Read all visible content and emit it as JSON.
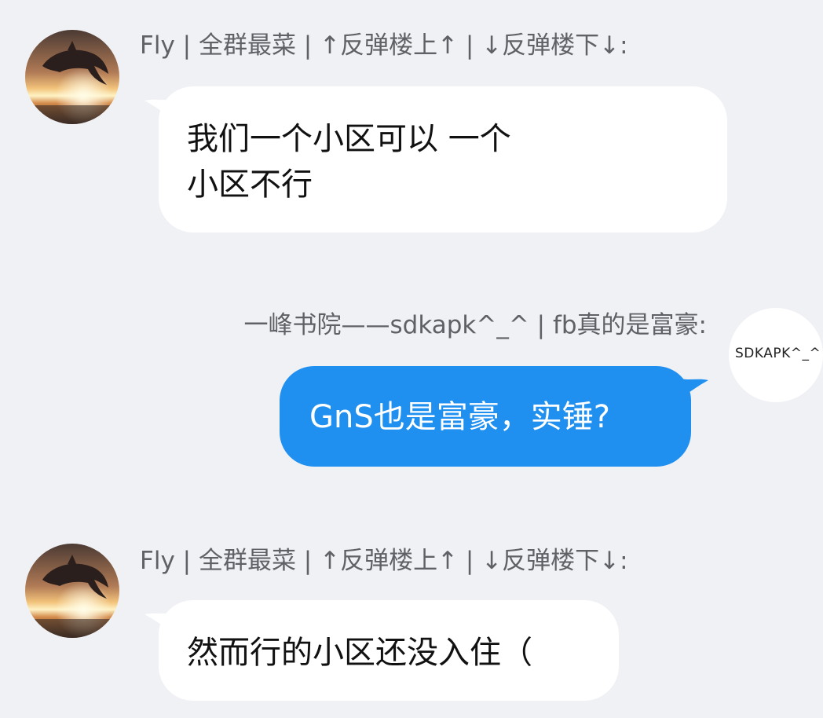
{
  "messages": [
    {
      "direction": "incoming",
      "sender": "Fly | 全群最菜 | ↑反弹楼上↑ | ↓反弹楼下↓:",
      "lines": [
        "我们一个小区可以 一个",
        "小区不行"
      ],
      "avatar_icon": "dolphin-sunset-avatar"
    },
    {
      "direction": "outgoing",
      "sender": "一峰书院——sdkapk^_^ | fb真的是富豪:",
      "lines": [
        "GnS也是富豪，实锤?"
      ],
      "avatar_text": "SDKAPK^_^"
    },
    {
      "direction": "incoming",
      "sender": "Fly | 全群最菜 | ↑反弹楼上↑ | ↓反弹楼下↓:",
      "lines": [
        "然而行的小区还没入住（"
      ],
      "avatar_icon": "dolphin-sunset-avatar"
    }
  ],
  "colors": {
    "background": "#f0f1f5",
    "incoming_bubble": "#ffffff",
    "outgoing_bubble": "#1f8ff0",
    "sender_text": "#5f6166"
  }
}
